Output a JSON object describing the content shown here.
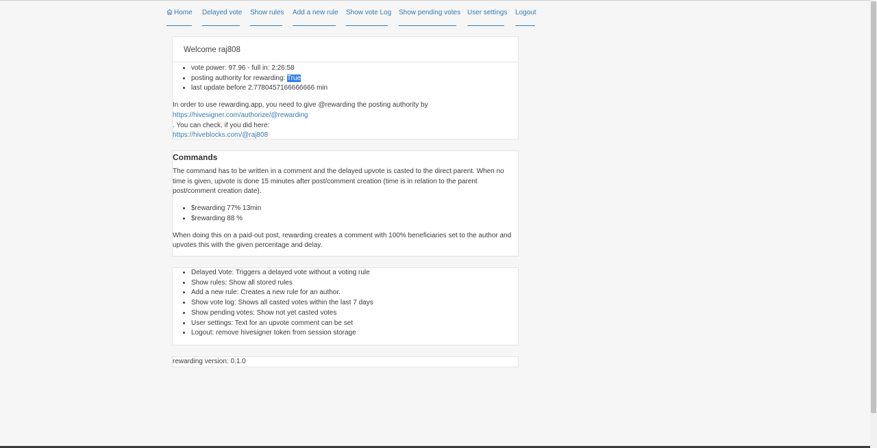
{
  "nav": {
    "items": [
      {
        "label": "Home",
        "icon": "home-icon"
      },
      {
        "label": "Delayed vote"
      },
      {
        "label": "Show rules"
      },
      {
        "label": "Add a new rule"
      },
      {
        "label": "Show vote Log"
      },
      {
        "label": "Show pending votes"
      },
      {
        "label": "User settings"
      },
      {
        "label": "Logout"
      }
    ]
  },
  "welcome": {
    "title": "Welcome raj808",
    "stats": {
      "vote_power": "vote power: 97.96 - full in: 2:26:58",
      "posting_authority_label": "posting authority for rewarding: ",
      "posting_authority_value": "True",
      "last_update": "last update before 2.7780457166666666 min"
    },
    "intro_text": "In order to use rewarding.app, you need to give @rewarding the posting authority by",
    "authorize_link": "https://hivesigner.com/authorize/@rewarding",
    "check_text": ". You can check, if you did here:",
    "check_link": "https://hiveblocks.com/@raj808"
  },
  "commands": {
    "title": "Commands",
    "description": "The command has to be written in a comment and the delayed upvote is casted to the direct parent. When no time is given, upvote is done 15 minutes after post/comment creation (time is in relation to the parent post/comment creation date).",
    "examples": [
      "$rewarding 77% 13min",
      "$rewarding 88 %"
    ],
    "note": "When doing this on a paid-out post, rewarding creates a comment with 100% beneficiaries set to the author and upvotes this with the given percentage and delay."
  },
  "features": {
    "items": [
      "Delayed Vote: Triggers a delayed vote without a voting rule",
      "Show rules: Show all stored rules",
      "Add a new rule: Creates a new rule for an author.",
      "Show vote log: Shows all casted votes within the last 7 days",
      "Show pending votes: Show not yet casted votes",
      "User settings: Text for an upvote comment can be set",
      "Logout: remove hivesigner token from session storage"
    ]
  },
  "footer": {
    "version": "rewarding version: 0.1.0"
  },
  "colors": {
    "link": "#337ab7",
    "highlight": "#2f7ff0",
    "background": "#f6f6f6"
  }
}
